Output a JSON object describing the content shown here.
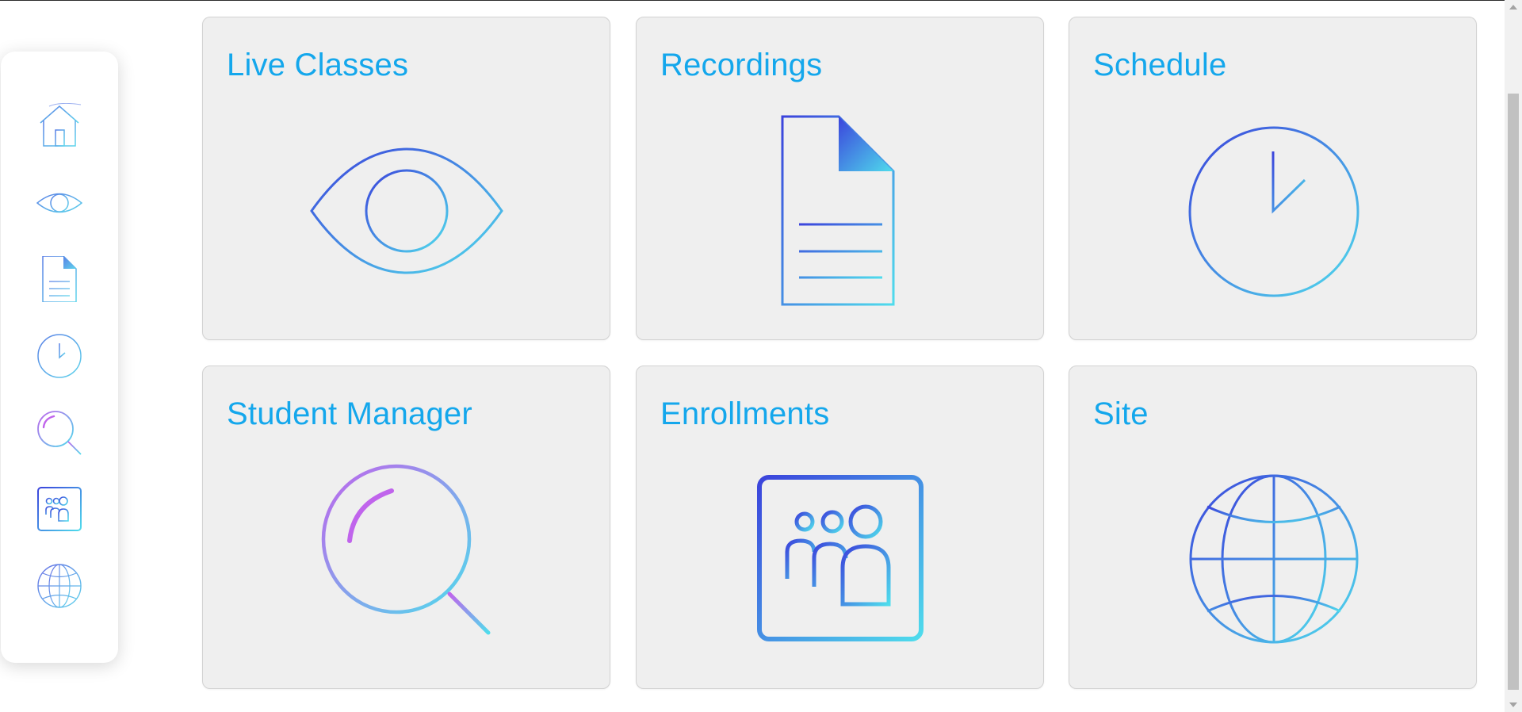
{
  "sidebar": {
    "items": [
      {
        "name": "home",
        "icon": "home-icon"
      },
      {
        "name": "live-classes",
        "icon": "eye-icon"
      },
      {
        "name": "recordings",
        "icon": "document-icon"
      },
      {
        "name": "schedule",
        "icon": "clock-icon"
      },
      {
        "name": "student-manager",
        "icon": "search-icon"
      },
      {
        "name": "enrollments",
        "icon": "people-icon"
      },
      {
        "name": "site",
        "icon": "globe-icon"
      }
    ]
  },
  "cards": [
    {
      "title": "Live Classes",
      "icon": "eye-icon"
    },
    {
      "title": "Recordings",
      "icon": "document-icon"
    },
    {
      "title": "Schedule",
      "icon": "clock-icon"
    },
    {
      "title": "Student Manager",
      "icon": "search-icon"
    },
    {
      "title": "Enrollments",
      "icon": "people-icon"
    },
    {
      "title": "Site",
      "icon": "globe-icon"
    }
  ],
  "colors": {
    "title": "#14a7ec",
    "gradient_start": "#3b43dc",
    "gradient_end": "#4fdcec",
    "search_start": "#c064ec",
    "search_end": "#4fdcec",
    "card_bg": "#efefef"
  }
}
